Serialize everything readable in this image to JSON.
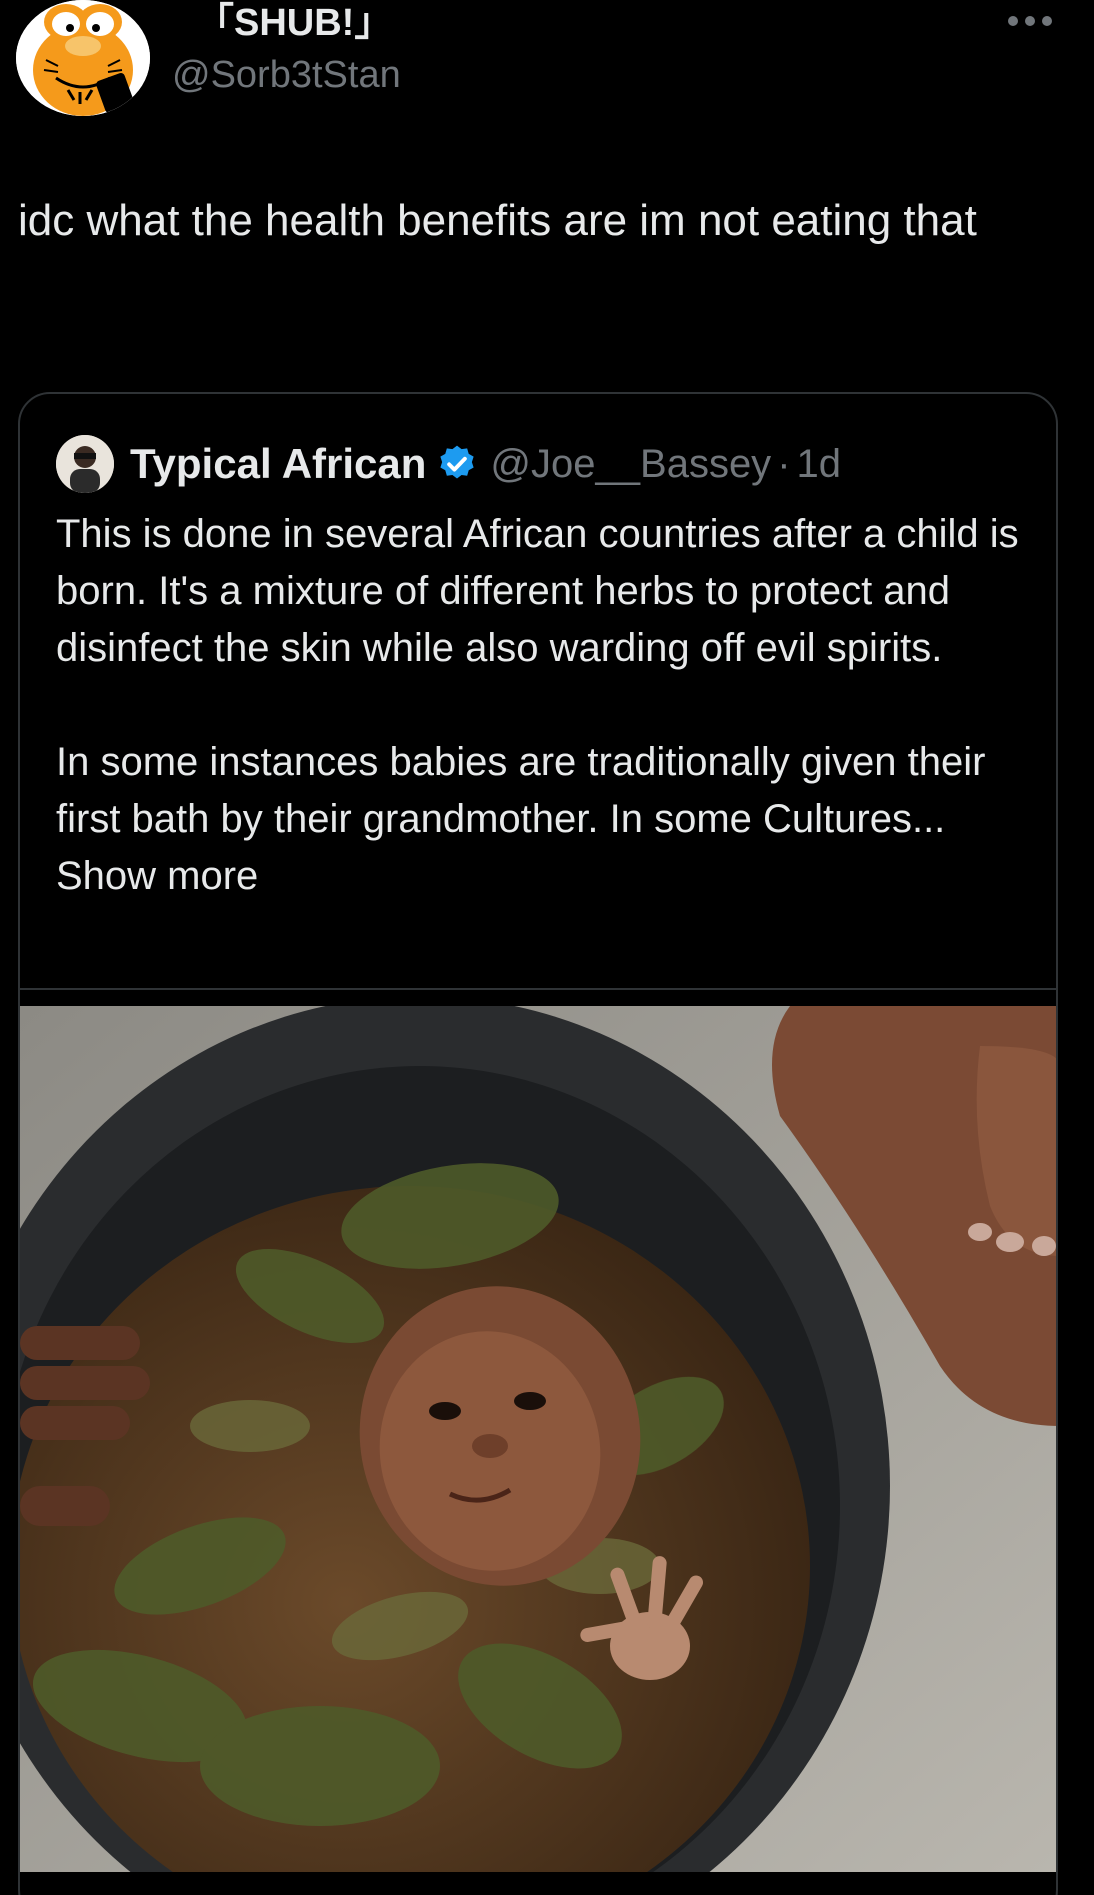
{
  "tweet": {
    "display_name": "「SHUB!」",
    "handle": "@Sorb3tStan",
    "text": "idc what the health benefits are im not eating that",
    "avatar_icon": "garfield-avatar-icon",
    "more_icon": "more-dots-icon"
  },
  "quote": {
    "name": "Typical African",
    "handle": "@Joe__Bassey",
    "separator": "·",
    "time": "1d",
    "verified_icon": "verified-badge-icon",
    "paragraph1": "This is done in several African countries after a child is born. It's a mixture of different herbs to protect and disinfect the skin while also warding off evil spirits.",
    "paragraph2": "In some instances babies are traditionally given their first bath by their grandmother. In some Cultures...",
    "show_more": "Show more",
    "photo_icon": "baby-herbal-bath-photo"
  },
  "colors": {
    "background": "#000000",
    "primary_text": "#e7e9ea",
    "secondary_text": "#71767b",
    "border": "#2f3336",
    "verified_blue": "#1d9bf0"
  }
}
